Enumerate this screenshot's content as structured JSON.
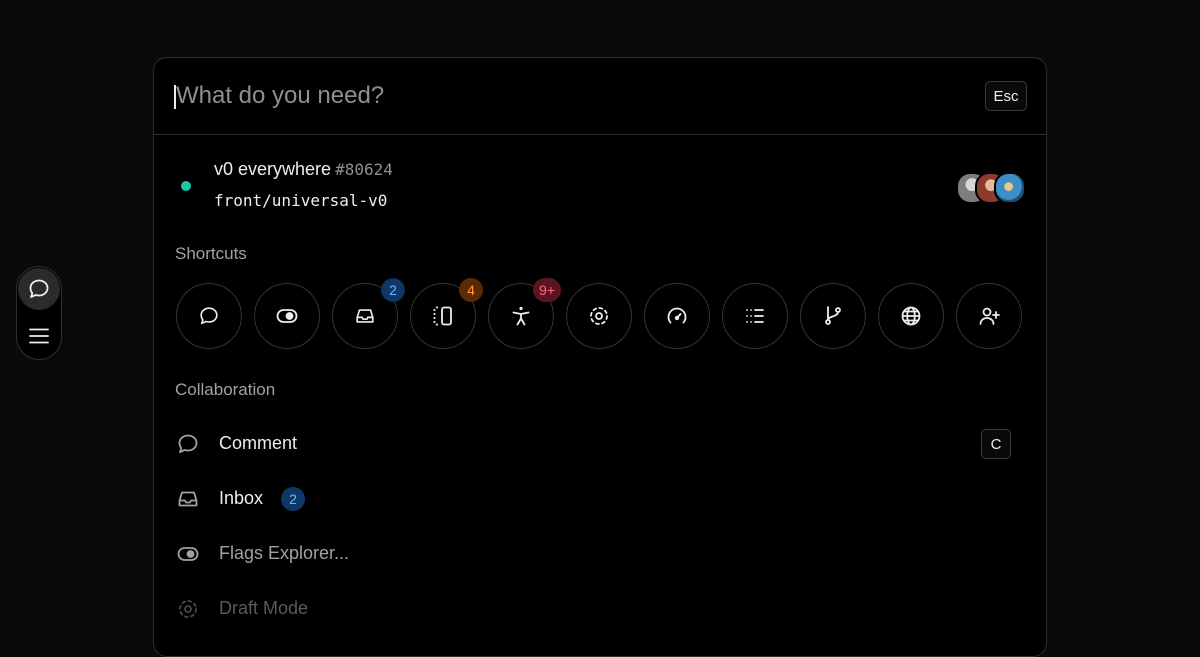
{
  "search": {
    "placeholder": "What do you need?",
    "value": "",
    "esc_label": "Esc"
  },
  "project": {
    "title": "v0 everywhere",
    "number": "#80624",
    "branch": "front/universal-v0",
    "status_color": "#1fc7a8"
  },
  "shortcuts_label": "Shortcuts",
  "shortcuts": [
    {
      "icon": "comment-icon",
      "badge": ""
    },
    {
      "icon": "toggle-icon",
      "badge": ""
    },
    {
      "icon": "inbox-icon",
      "badge": "2"
    },
    {
      "icon": "layout-panel-icon",
      "badge": "4"
    },
    {
      "icon": "accessibility-icon",
      "badge": "9+"
    },
    {
      "icon": "draft-mode-icon",
      "badge": ""
    },
    {
      "icon": "gauge-icon",
      "badge": ""
    },
    {
      "icon": "list-icon",
      "badge": ""
    },
    {
      "icon": "git-branch-icon",
      "badge": ""
    },
    {
      "icon": "globe-icon",
      "badge": ""
    },
    {
      "icon": "user-plus-icon",
      "badge": ""
    }
  ],
  "collaboration_label": "Collaboration",
  "items": [
    {
      "label": "Comment",
      "shortcut": "C",
      "icon": "comment-icon"
    },
    {
      "label": "Inbox",
      "count": "2",
      "icon": "inbox-icon"
    },
    {
      "label": "Flags Explorer...",
      "icon": "toggle-icon"
    },
    {
      "label": "Draft Mode",
      "icon": "draft-mode-icon"
    }
  ],
  "colors": {
    "accent_blue": "#6db3ff",
    "accent_orange": "#ff9a3d",
    "accent_red": "#ff6b7d",
    "status_green": "#1fc7a8"
  }
}
